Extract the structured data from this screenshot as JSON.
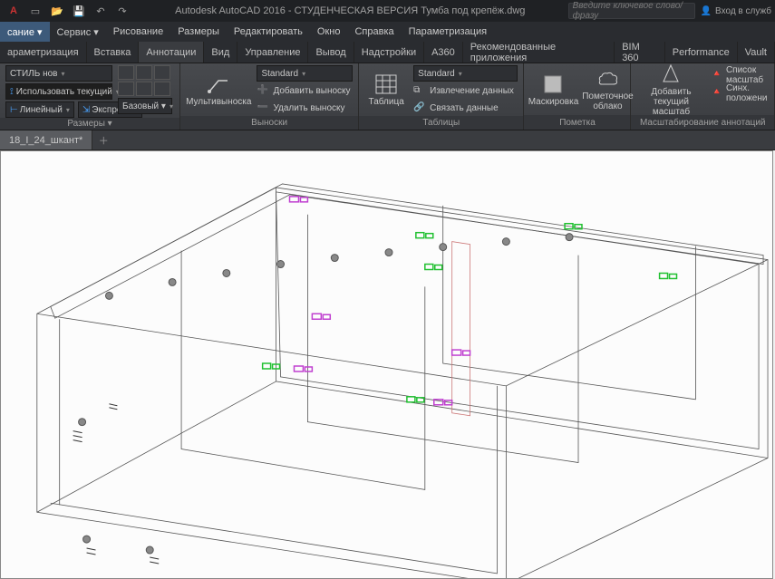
{
  "title": "Autodesk AutoCAD 2016 - СТУДЕНЧЕСКАЯ ВЕРСИЯ    Тумба под крепёж.dwg",
  "search_placeholder": "Введите ключевое слово/фразу",
  "login_label": "Вход в служб",
  "menu": [
    "сание ▾",
    "Сервис ▾",
    "Рисование",
    "Размеры",
    "Редактировать",
    "Окно",
    "Справка",
    "Параметризация"
  ],
  "tabs": [
    "араметризация",
    "Вставка",
    "Аннотации",
    "Вид",
    "Управление",
    "Вывод",
    "Надстройки",
    "A360",
    "Рекомендованные приложения",
    "BIM 360",
    "Performance",
    "Vault"
  ],
  "active_tab": 2,
  "sizes": {
    "style": "СТИЛЬ нов",
    "use_current": "Использовать текущий",
    "linear": "Линейный",
    "express": "Экспресс",
    "basic": "Базовый ▾",
    "label": "Размеры ▾"
  },
  "leaders": {
    "mleader": "Мультивыноска",
    "std": "Standard",
    "add": "Добавить выноску",
    "rem": "Удалить выноску",
    "label": "Выноски"
  },
  "tables": {
    "std": "Standard",
    "table": "Таблица",
    "extract": "Извлечение данных",
    "link": "Связать данные",
    "label": "Таблицы"
  },
  "markup": {
    "mask": "Маскировка",
    "cloud": "Пометочное облако",
    "label": "Пометка"
  },
  "anno": {
    "add": "Добавить текущий масштаб",
    "list": "Список масштаб",
    "sync": "Синх. положени",
    "label": "Масштабирование аннотаций"
  },
  "doc_tab": "18_I_24_шкант*"
}
